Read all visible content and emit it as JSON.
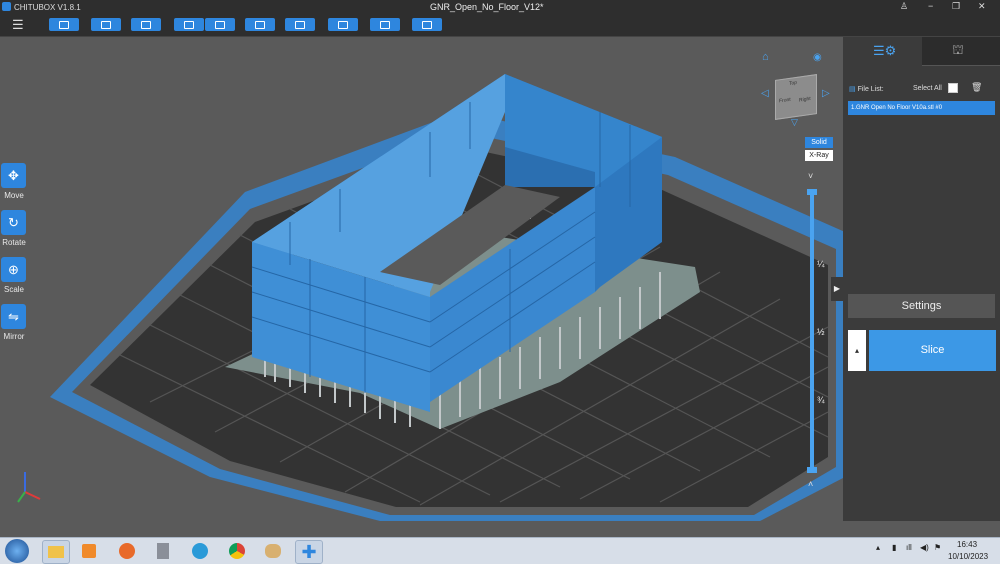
{
  "window": {
    "app_name": "CHITUBOX V1.8.1",
    "document_title": "GNR_Open_No_Floor_V12*",
    "controls": [
      "−",
      "❐",
      "✕"
    ]
  },
  "left_tools": [
    {
      "name": "move",
      "label": "Move",
      "icon": "move-icon",
      "glyph": "✥"
    },
    {
      "name": "rotate",
      "label": "Rotate",
      "icon": "rotate-icon",
      "glyph": "↻"
    },
    {
      "name": "scale",
      "label": "Scale",
      "icon": "scale-icon",
      "glyph": "⊕"
    },
    {
      "name": "mirror",
      "label": "Mirror",
      "icon": "mirror-icon",
      "glyph": "⇋"
    }
  ],
  "view_mode": {
    "solid": "Solid",
    "xray": "X-Ray"
  },
  "view_cube": {
    "top": "Top",
    "front": "Front",
    "right": "Right"
  },
  "layer_slider": {
    "marks": [
      "¼",
      "½",
      "¾"
    ],
    "up_arrow": "˄",
    "down_arrow": "˅"
  },
  "right_panel": {
    "file_list_label": "File List:",
    "select_all_label": "Select All",
    "files": [
      "1.GNR Open No Floor V10a.stl #0"
    ],
    "settings_label": "Settings",
    "slice_label": "Slice",
    "slice_options_arrow": "▴",
    "collapse_arrow": "▶"
  },
  "taskbar": {
    "start": "start-orb",
    "time": "16:43",
    "date": "10/10/2023"
  },
  "colors": {
    "accent": "#2e86de",
    "model": "#3a8ad4",
    "supports": "#b9bfc2",
    "grid": "#2f2f2f",
    "platform_frame": "#3a7fc0"
  }
}
